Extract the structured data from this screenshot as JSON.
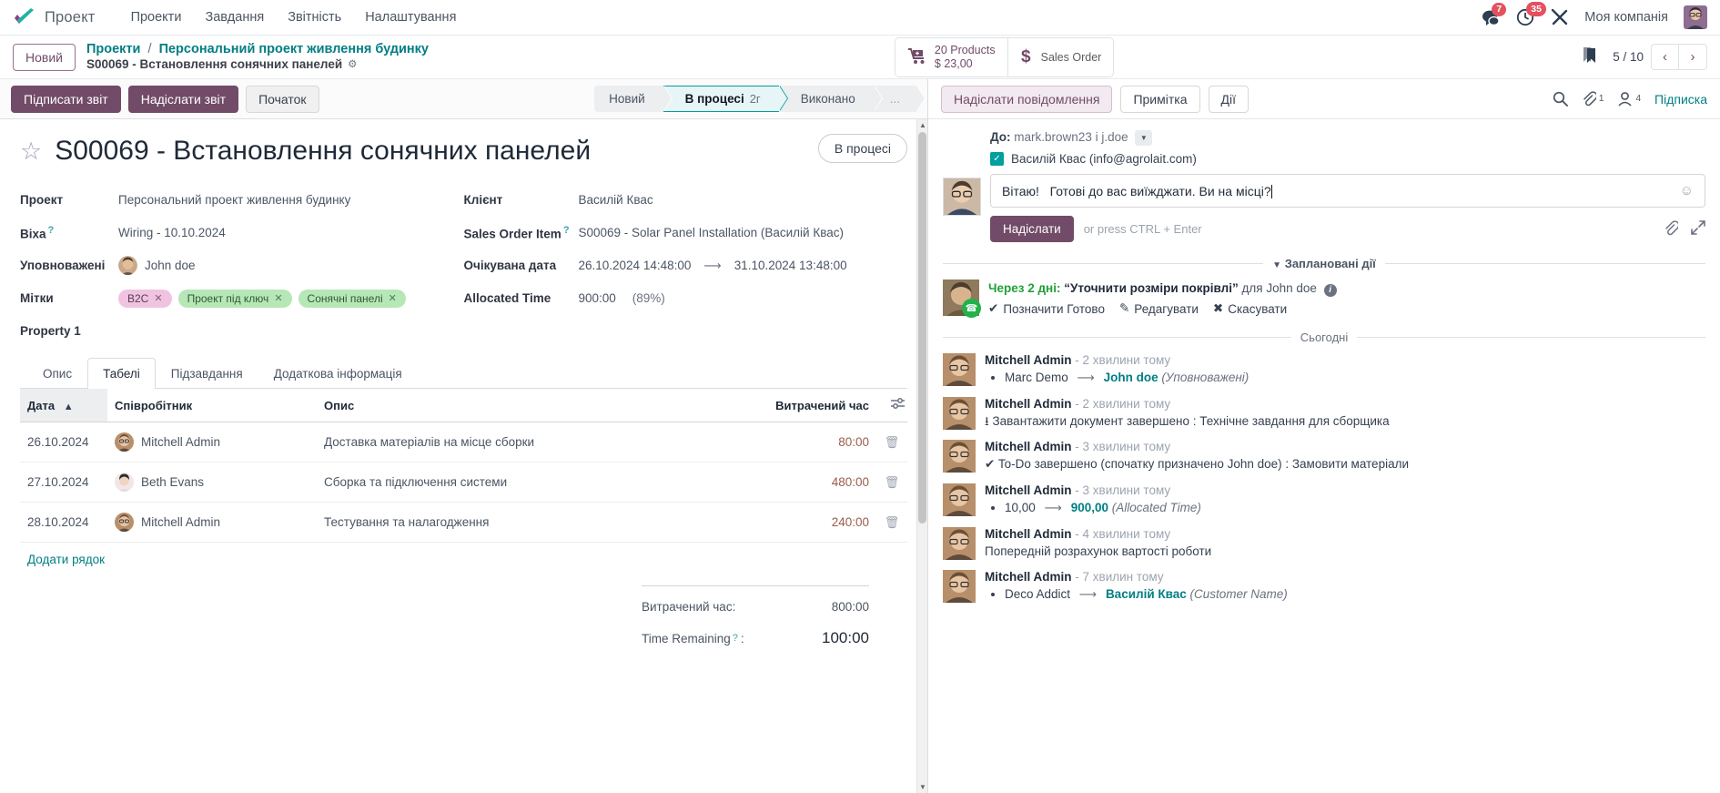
{
  "navbar": {
    "brand": "Проект",
    "menus": [
      "Проекти",
      "Завдання",
      "Звітність",
      "Налаштування"
    ],
    "messages_badge": "7",
    "activities_badge": "35",
    "company": "Моя компанія"
  },
  "breadcrumb": {
    "status_pill": "Новий",
    "root": "Проекти",
    "separator": "/",
    "parent": "Персональний проект живлення будинку",
    "record": "S00069 - Встановлення сонячних панелей",
    "stat_products_line1": "20 Products",
    "stat_products_line2": "$ 23,00",
    "stat_sales_order": "Sales Order",
    "pager": "5 / 10"
  },
  "control": {
    "buttons": [
      {
        "label": "Підписати звіт",
        "style": "primary"
      },
      {
        "label": "Надіслати звіт",
        "style": "primary"
      },
      {
        "label": "Початок",
        "style": "default"
      }
    ],
    "stages": [
      {
        "label": "Новий",
        "sub": "",
        "active": false
      },
      {
        "label": "В процесі",
        "sub": "2г",
        "active": true
      },
      {
        "label": "Виконано",
        "sub": "",
        "active": false
      },
      {
        "label": "...",
        "sub": "",
        "active": false
      }
    ]
  },
  "record": {
    "title": "S00069 - Встановлення сонячних панелей",
    "state_button": "В процесі",
    "left_fields": [
      {
        "label": "Проект",
        "tip": false,
        "value": "Персональний проект живлення будинку",
        "type": "text"
      },
      {
        "label": "Віха",
        "tip": true,
        "value": "Wiring - 10.10.2024",
        "type": "text"
      },
      {
        "label": "Уповноважені",
        "tip": false,
        "value": "John doe",
        "type": "avatar"
      },
      {
        "label": "Мітки",
        "tip": false,
        "value": "",
        "type": "tags"
      }
    ],
    "tags": [
      {
        "text": "B2C",
        "color": "pink"
      },
      {
        "text": "Проект під ключ",
        "color": "green"
      },
      {
        "text": "Сонячні панелі",
        "color": "green"
      }
    ],
    "property_label": "Property 1",
    "right_fields": [
      {
        "label": "Клієнт",
        "tip": false,
        "value": "Василій Квас",
        "extra": ""
      },
      {
        "label": "Sales Order Item",
        "tip": true,
        "value": "S00069 - Solar Panel Installation (Василій Квас)",
        "extra": ""
      },
      {
        "label": "Очікувана дата",
        "tip": false,
        "value": "26.10.2024 14:48:00",
        "extra": "31.10.2024 13:48:00"
      },
      {
        "label": "Allocated Time",
        "tip": false,
        "value": "900:00",
        "extra2": "(89%)"
      }
    ]
  },
  "notebook": {
    "tabs": [
      {
        "label": "Опис",
        "active": false
      },
      {
        "label": "Табелі",
        "active": true
      },
      {
        "label": "Підзавдання",
        "active": false
      },
      {
        "label": "Додаткова інформація",
        "active": false
      }
    ],
    "columns": [
      "Дата",
      "Співробітник",
      "Опис",
      "Витрачений час"
    ],
    "rows": [
      {
        "date": "26.10.2024",
        "employee": "Mitchell Admin",
        "description": "Доставка матеріалів на місце сборки",
        "hours": "80:00"
      },
      {
        "date": "27.10.2024",
        "employee": "Beth Evans",
        "description": "Сборка та підключення системи",
        "hours": "480:00"
      },
      {
        "date": "28.10.2024",
        "employee": "Mitchell Admin",
        "description": "Тестування та налагодження",
        "hours": "240:00"
      }
    ],
    "add_row": "Додати рядок",
    "totals": [
      {
        "label": "Витрачений час:",
        "value": "800:00",
        "big": false
      },
      {
        "label": "Time Remaining",
        "value": "100:00",
        "big": true,
        "tip": true
      }
    ]
  },
  "chatter": {
    "send_message_tab": "Надіслати повідомлення",
    "log_note_tab": "Примітка",
    "activities_tab": "Дії",
    "attachment_count": "1",
    "follower_count": "4",
    "follow_label": "Підписка",
    "recipients_prefix": "До:",
    "recipients": "mark.brown23 і j.doe",
    "checkbox_recipient": "Василій Квас (info@agrolait.com)",
    "compose_text_part1": "Вітаю!",
    "compose_text_part2": "Готові до вас виїжджати. Ви на місці?",
    "send_button": "Надіслати",
    "send_hint": "or press CTRL + Enter",
    "planned_divider": "Заплановані дії",
    "today_divider": "Сьогодні",
    "activity": {
      "when": "Через 2 дні:",
      "summary": "“Уточнити розміри покрівлі”",
      "assignee": "для John doe",
      "action_done": "Позначити Готово",
      "action_edit": "Редагувати",
      "action_cancel": "Скасувати"
    },
    "messages": [
      {
        "author": "Mitchell Admin",
        "time": "- 2 хвилини тому",
        "kind": "tracking",
        "bullet_old": "Marc Demo",
        "bullet_new": "John doe",
        "bullet_field": "(Уповноважені)"
      },
      {
        "author": "Mitchell Admin",
        "time": "- 2 хвилини тому",
        "kind": "plain",
        "text": "Завантажити документ завершено : Технічне завдання для сборщика"
      },
      {
        "author": "Mitchell Admin",
        "time": "- 3 хвилини тому",
        "kind": "plain",
        "text": "To-Do завершено (спочатку призначено John doe) : Замовити матеріали"
      },
      {
        "author": "Mitchell Admin",
        "time": "- 3 хвилини тому",
        "kind": "tracking",
        "bullet_old": "10,00",
        "bullet_new": "900,00",
        "bullet_field": "(Allocated Time)"
      },
      {
        "author": "Mitchell Admin",
        "time": "- 4 хвилини тому",
        "kind": "plain",
        "text": "Попередній розрахунок вартості роботи"
      },
      {
        "author": "Mitchell Admin",
        "time": "- 7 хвилин тому",
        "kind": "tracking",
        "bullet_old": "Deco Addict",
        "bullet_new": "Василій Квас",
        "bullet_field": "(Customer Name)"
      }
    ]
  },
  "colors": {
    "brand": "#714b67",
    "accent_teal": "#017e84",
    "badge_red": "#e3515f",
    "green": "#21a038"
  }
}
